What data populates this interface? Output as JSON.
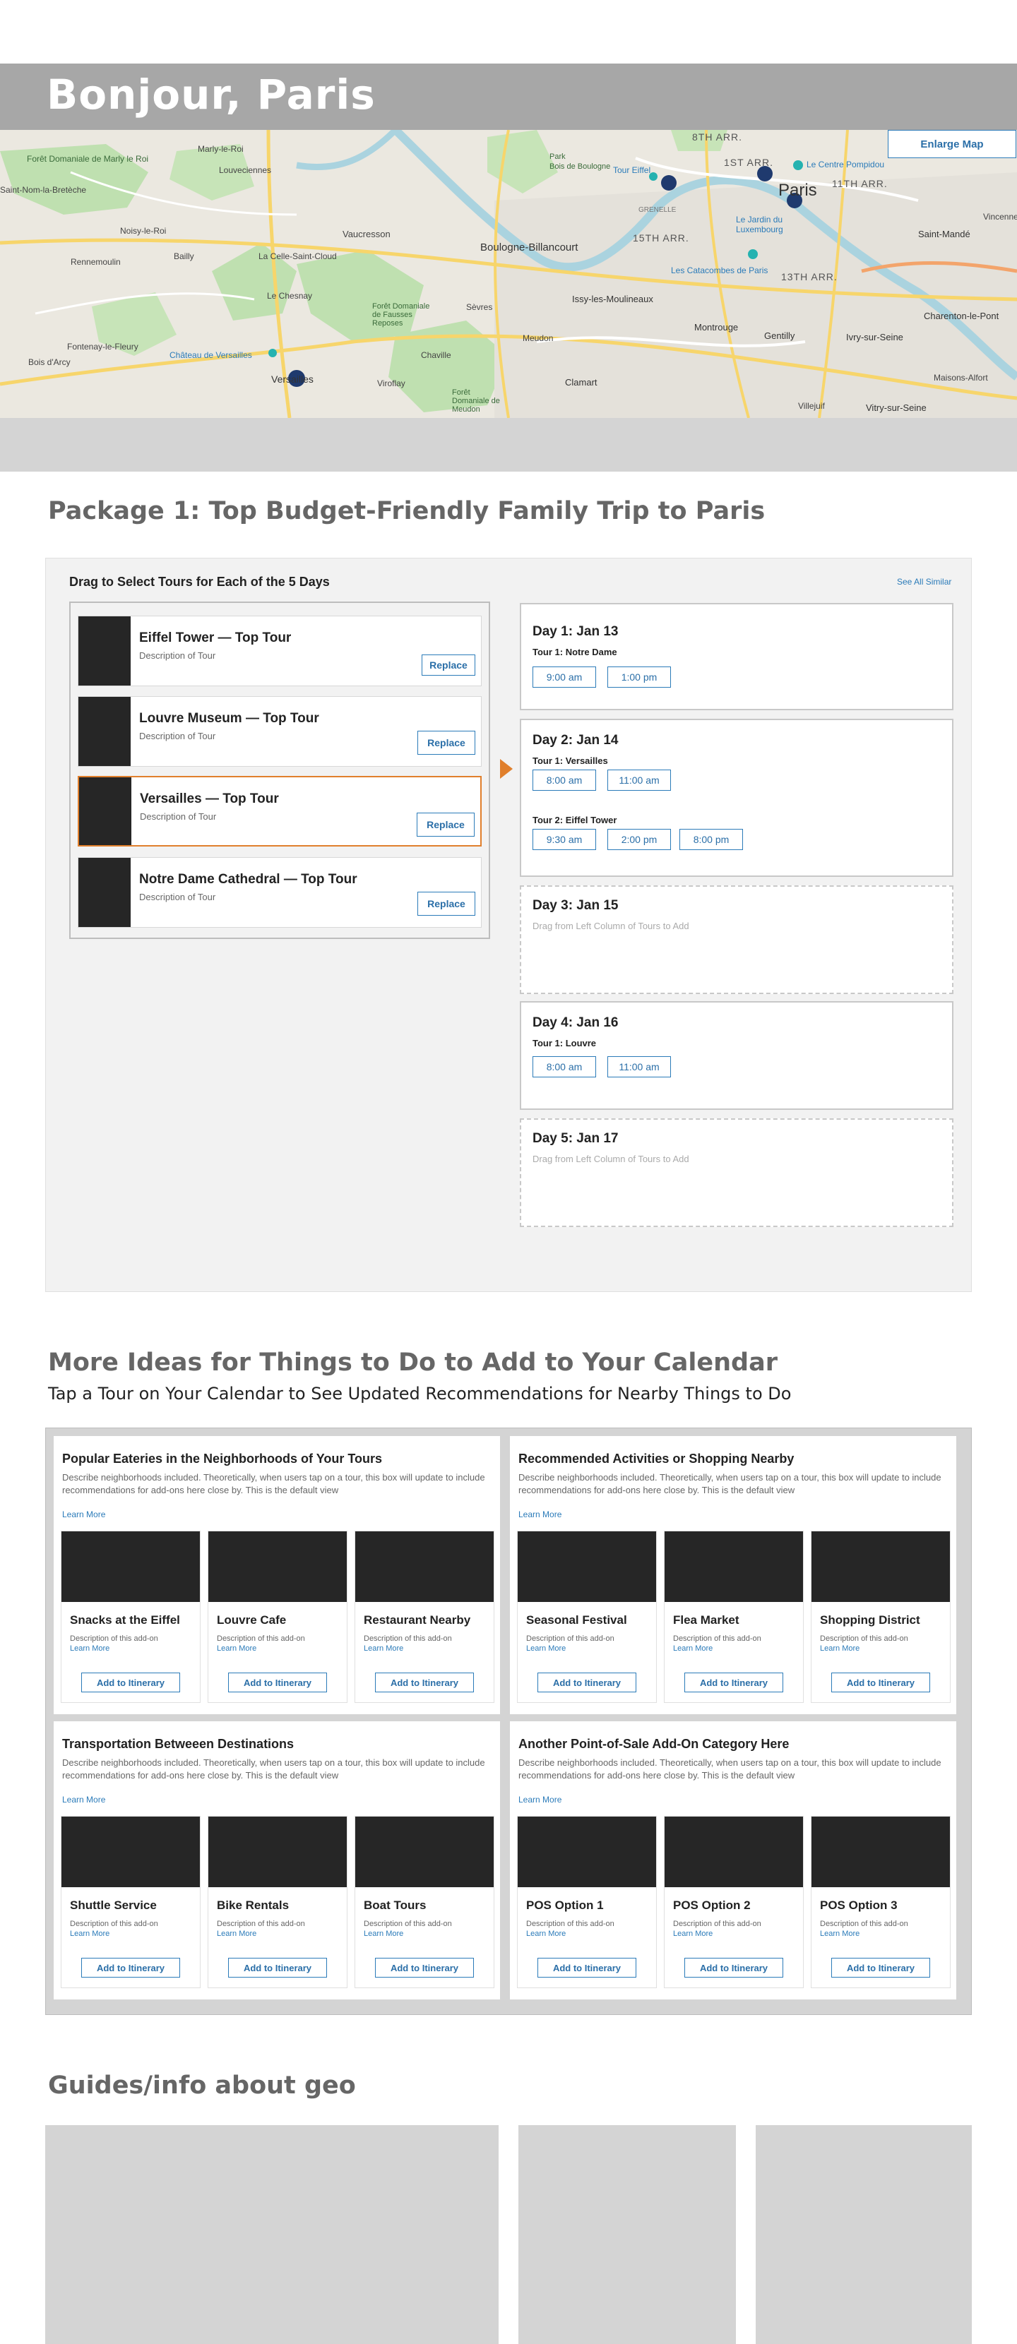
{
  "hero": {
    "title": "Bonjour, Paris"
  },
  "map": {
    "enlarge_label": "Enlarge Map",
    "labels": {
      "foret_domaniale": "Forêt Domaniale de Marly le Roi",
      "marly": "Marly-le-Roi",
      "louveciennes": "Louveciennes",
      "saint_nom": "Saint-Nom-la-Bretèche",
      "noisy": "Noisy-le-Roi",
      "bailly": "Bailly",
      "rennemoulin": "Rennemoulin",
      "vaucresson": "Vaucresson",
      "la_celle": "La Celle-Saint-Cloud",
      "le_chesnay": "Le Chesnay",
      "fausses_reposes": "Forêt Domaniale de Fausses Reposes",
      "boulogne": "Boulogne-Billancourt",
      "sevres": "Sèvres",
      "meudon": "Meudon",
      "foret_meudon": "Forêt Domaniale de Meudon",
      "chaville": "Chaville",
      "viroflay": "Viroflay",
      "chateau": "Château de Versailles",
      "versailles": "Versailles",
      "fontenay": "Fontenay-le-Fleury",
      "bois_arcy": "Bois d'Arcy",
      "issy": "Issy-les-Moulineaux",
      "clamart": "Clamart",
      "montrouge": "Montrouge",
      "gentilly": "Gentilly",
      "ivry": "Ivry-sur-Seine",
      "villejuif": "Villejuif",
      "vitry": "Vitry-sur-Seine",
      "maisons": "Maisons-Alfort",
      "charenton": "Charenton-le-Pont",
      "saint_mande": "Saint-Mandé",
      "vincennes": "Vincennes",
      "paris": "Paris",
      "arr8": "8TH ARR.",
      "arr1": "1ST ARR.",
      "arr11": "11TH ARR.",
      "arr15": "15TH ARR.",
      "arr13": "13TH ARR.",
      "tour_eiffel": "Tour Eiffel",
      "centre_pompidou": "Le Centre Pompidou",
      "jardin": "Le Jardin du Luxembourg",
      "catacombes": "Les Catacombes de Paris",
      "grenelle": "GRENELLE",
      "bois_boulogne": "Bois de Boulogne",
      "park": "Park"
    }
  },
  "package": {
    "heading": "Package 1: Top Budget-Friendly Family Trip to Paris",
    "drag_title": "Drag to Select Tours for Each of the 5 Days",
    "see_all": "See All Similar",
    "tours": [
      {
        "name": "Eiffel Tower — Top Tour",
        "desc": "Description of Tour",
        "button": "Replace"
      },
      {
        "name": "Louvre Museum — Top Tour",
        "desc": "Description of Tour",
        "button": "Replace"
      },
      {
        "name": "Versailles — Top Tour",
        "desc": "Description of Tour",
        "button": "Replace"
      },
      {
        "name": "Notre Dame Cathedral — Top Tour",
        "desc": "Description of Tour",
        "button": "Replace"
      }
    ],
    "days": [
      {
        "title": "Day 1: Jan 13",
        "tours": [
          {
            "label": "Tour 1: Notre Dame",
            "times": [
              "9:00 am",
              "1:00 pm"
            ]
          }
        ]
      },
      {
        "title": "Day 2: Jan 14",
        "tours": [
          {
            "label": "Tour 1: Versailles",
            "times": [
              "8:00 am",
              "11:00 am"
            ]
          },
          {
            "label": "Tour 2: Eiffel Tower",
            "times": [
              "9:30 am",
              "2:00 pm",
              "8:00 pm"
            ]
          }
        ]
      },
      {
        "title": "Day 3: Jan 15",
        "hint": "Drag from Left Column of Tours to Add"
      },
      {
        "title": "Day 4: Jan 16",
        "tours": [
          {
            "label": "Tour 1: Louvre",
            "times": [
              "8:00 am",
              "11:00 am"
            ]
          }
        ]
      },
      {
        "title": "Day 5: Jan 17",
        "hint": "Drag from Left Column of Tours to Add"
      }
    ]
  },
  "ideas": {
    "heading": "More Ideas for Things to Do to Add to Your Calendar",
    "subheading": "Tap a Tour on Your Calendar to See Updated Recommendations for Nearby Things to Do",
    "categories": [
      {
        "title": "Popular Eateries in the Neighborhoods of Your Tours",
        "desc": "Describe neighborhoods included. Theoretically, when users tap on a tour, this box will update to include recommendations for add-ons here close by. This is the default view",
        "learn": "Learn More",
        "items": [
          {
            "title": "Snacks at the Eiffel",
            "desc": "Description of this add-on",
            "learn": "Learn More",
            "button": "Add to Itinerary"
          },
          {
            "title": "Louvre Cafe",
            "desc": "Description of this add-on",
            "learn": "Learn More",
            "button": "Add to Itinerary"
          },
          {
            "title": "Restaurant Nearby",
            "desc": "Description of this add-on",
            "learn": "Learn More",
            "button": "Add to Itinerary"
          }
        ]
      },
      {
        "title": "Recommended Activities or Shopping Nearby",
        "desc": "Describe neighborhoods included. Theoretically, when users tap on a tour, this box will update to include recommendations for add-ons here close by. This is the default view",
        "learn": "Learn More",
        "items": [
          {
            "title": "Seasonal Festival",
            "desc": "Description of this add-on",
            "learn": "Learn More",
            "button": "Add to Itinerary"
          },
          {
            "title": "Flea Market",
            "desc": "Description of this add-on",
            "learn": "Learn More",
            "button": "Add to Itinerary"
          },
          {
            "title": "Shopping District",
            "desc": "Description of this add-on",
            "learn": "Learn More",
            "button": "Add to Itinerary"
          }
        ]
      },
      {
        "title": "Transportation Betweeen Destinations",
        "desc": "Describe neighborhoods included. Theoretically, when users tap on a tour, this box will update to include recommendations for add-ons here close by. This is the default view",
        "learn": "Learn More",
        "items": [
          {
            "title": "Shuttle Service",
            "desc": "Description of this add-on",
            "learn": "Learn More",
            "button": "Add to Itinerary"
          },
          {
            "title": "Bike Rentals",
            "desc": "Description of this add-on",
            "learn": "Learn More",
            "button": "Add to Itinerary"
          },
          {
            "title": "Boat Tours",
            "desc": "Description of this add-on",
            "learn": "Learn More",
            "button": "Add to Itinerary"
          }
        ]
      },
      {
        "title": "Another Point-of-Sale Add-On Category Here",
        "desc": "Describe neighborhoods included. Theoretically, when users tap on a tour, this box will update to include recommendations for add-ons here close by. This is the default view",
        "learn": "Learn More",
        "items": [
          {
            "title": "POS Option 1",
            "desc": "Description of this add-on",
            "learn": "Learn More",
            "button": "Add to Itinerary"
          },
          {
            "title": "POS Option 2",
            "desc": "Description of this add-on",
            "learn": "Learn More",
            "button": "Add to Itinerary"
          },
          {
            "title": "POS Option 3",
            "desc": "Description of this add-on",
            "learn": "Learn More",
            "button": "Add to Itinerary"
          }
        ]
      }
    ]
  },
  "guides": {
    "heading": "Guides/info about geo"
  },
  "colors": {
    "accent": "#2b7bb9",
    "highlight": "#e07f2c",
    "hero_band": "#a7a7a7",
    "placeholder": "#d4d4d4"
  }
}
